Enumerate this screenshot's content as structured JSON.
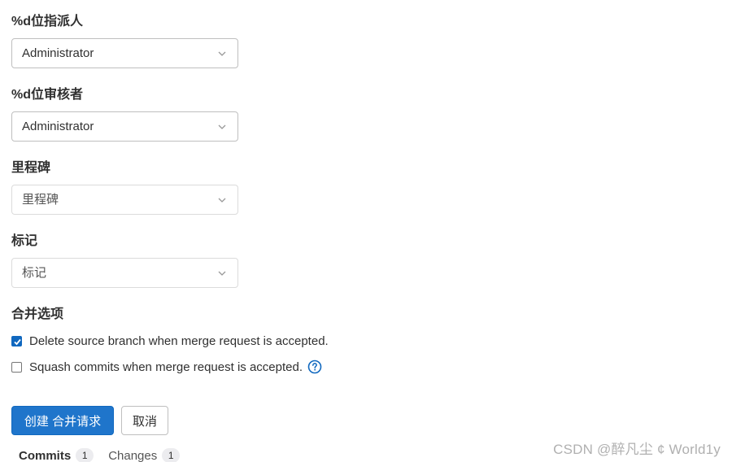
{
  "form": {
    "assignee": {
      "label": "%d位指派人",
      "value": "Administrator"
    },
    "reviewer": {
      "label": "%d位审核者",
      "value": "Administrator"
    },
    "milestone": {
      "label": "里程碑",
      "placeholder": "里程碑"
    },
    "labels": {
      "label": "标记",
      "placeholder": "标记"
    },
    "merge_options": {
      "label": "合并选项",
      "delete_source_branch": {
        "text": "Delete source branch when merge request is accepted.",
        "checked": true
      },
      "squash_commits": {
        "text": "Squash commits when merge request is accepted.",
        "checked": false
      }
    }
  },
  "actions": {
    "create_label": "创建 合并请求",
    "cancel_label": "取消"
  },
  "tabs": [
    {
      "label": "Commits",
      "count": "1",
      "active": true
    },
    {
      "label": "Changes",
      "count": "1",
      "active": false
    }
  ],
  "watermark": "CSDN @醉凡尘 ¢  World1y",
  "colors": {
    "primary": "#1f75cb",
    "checkbox_checked": "#1068bf",
    "help_icon": "#1068bf",
    "text": "#303030"
  },
  "icons": {
    "select_chevron": "chevron-down-icon",
    "checkbox_checked": "check-icon",
    "help": "question-circle-icon"
  }
}
